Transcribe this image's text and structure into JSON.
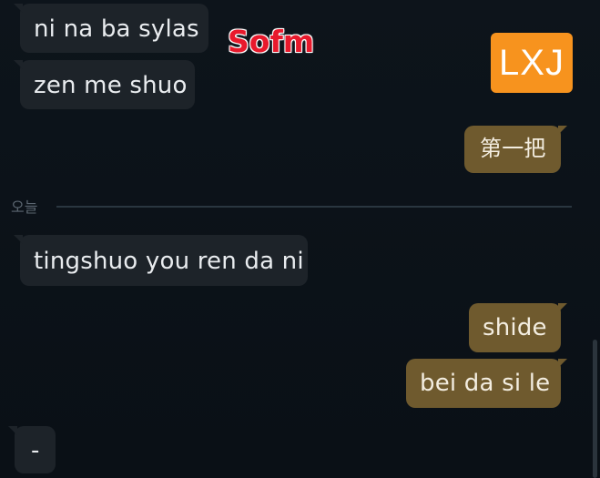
{
  "messages": {
    "m1": "ni na ba sylas",
    "m2": "zen me shuo",
    "m3": "第一把",
    "m4": "tingshuo you ren da ni",
    "m5": "shide",
    "m6": "bei da si le",
    "m7": "-"
  },
  "divider": {
    "label": "오늘"
  },
  "overlays": {
    "top_name": "Sofm",
    "badge": "LXJ"
  },
  "colors": {
    "background": "#0b1117",
    "incoming_bubble": "#1d2329",
    "outgoing_bubble": "#6f5a2e",
    "sofm_red": "#e8192c",
    "badge_orange": "#f7931e"
  }
}
